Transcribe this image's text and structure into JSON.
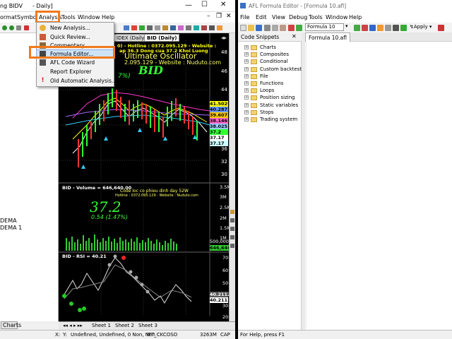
{
  "left_window": {
    "title_a": "ng BIDV",
    "title_b": "- Daily]",
    "menu": [
      "ormat",
      "Symbo",
      "Analysis",
      "Tools",
      "Window",
      "Help"
    ],
    "chart_tabs": [
      "IDEX (Daily)",
      "BID (Daily)"
    ],
    "left_items": [
      "DEMA",
      "DEMA 1"
    ],
    "left_tab": "Charts",
    "sheet_tabs": [
      "Sheet 1",
      "Sheet 2",
      "Sheet 3"
    ],
    "status": [
      "X:",
      "Y:",
      "Undefined, Undefined, 0 Non, Non",
      "IFT_CKCOSO",
      "3263M",
      "CAP"
    ]
  },
  "analysis_menu": {
    "items": [
      {
        "label": "New Analysis...",
        "icon": "chart-icon"
      },
      {
        "label": "Quick Review...",
        "icon": "review-icon"
      },
      {
        "label": "Commentary",
        "icon": "commentary-icon"
      },
      {
        "label": "Formula Editor...",
        "icon": "formula-icon"
      },
      {
        "label": "AFL Code Wizard",
        "icon": "wizard-icon"
      },
      {
        "label": "Report Explorer",
        "icon": ""
      },
      {
        "label": "Old Automatic Analysis...",
        "icon": "warning-icon"
      }
    ],
    "highlighted": "Formula Editor..."
  },
  "chart_text": {
    "header1": "0) - Hotline : 0372.095.129 - Website :",
    "header2": "ap 36.3  Dong cua 37.2  Khoi Luong",
    "osc": "Ultimate Oscillator",
    "contact": "2.095.129 - Website : Nuduto.com",
    "big_ticker": "BID",
    "pct": "7%)",
    "price_labels": [
      "48",
      "46",
      "44",
      "42",
      "40",
      "38",
      "36",
      "34",
      "32",
      "30"
    ],
    "price_tags": [
      "41.5029",
      "40.287",
      "39.6075",
      "38.146",
      "38.025",
      "37.2",
      "37.17",
      "37.17"
    ],
    "vol_title": "BID - Volume = 646,640.00",
    "vol_sub1": "Code loc co phieu dinh day 52W",
    "vol_sub2": "Hotline : 0372.095.129 - Website : Nuduto.com",
    "vol_big": "37.2",
    "vol_change": "0.54 (1.47%)",
    "vol_labels": [
      "3.5M",
      "3M",
      "2.5M",
      "2M",
      "1.5M",
      "1M",
      "500,000"
    ],
    "vol_tag": "646,640",
    "rsi_title": "BID - RSI = 40.21",
    "rsi_labels": [
      "70",
      "60",
      "50",
      "40",
      "30",
      "20"
    ],
    "rsi_tags": [
      "40.2112",
      "40.2112"
    ]
  },
  "right_window": {
    "title": "AFL Formula Editor - [Formula 10.afl]",
    "menu": [
      "File",
      "Edit",
      "View",
      "Debug",
      "Tools",
      "Window",
      "Help"
    ],
    "formula_select": "Formula 10",
    "apply_label": "Apply",
    "snippets_title": "Code Snippets",
    "snippets": [
      "Charts",
      "Composites",
      "Conditional",
      "Custom backtest",
      "File",
      "Functions",
      "Loops",
      "Position sizing",
      "Static variables",
      "Stops",
      "Trading system"
    ],
    "editor_tab": "Formula 10.afl",
    "status": "For Help, press F1"
  },
  "colors": {
    "highlight": "#f07a1e",
    "chart_bg": "#000000"
  }
}
